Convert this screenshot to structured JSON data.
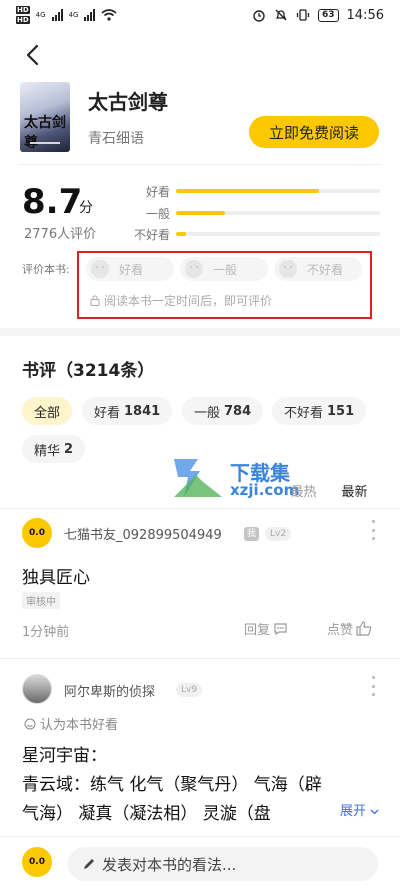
{
  "status_bar": {
    "left_tags": [
      "HD",
      "HD"
    ],
    "network": [
      "4G",
      "4G"
    ],
    "battery": "63",
    "time": "14:56"
  },
  "book": {
    "title": "太古剑尊",
    "author": "青石细语",
    "cover_text": "太古剑尊",
    "read_button": "立即免费阅读"
  },
  "rating": {
    "score": "8.7",
    "unit": "分",
    "count": "2776人评价",
    "bars": [
      {
        "label": "好看",
        "fraction": 0.7
      },
      {
        "label": "一般",
        "fraction": 0.24
      },
      {
        "label": "不好看",
        "fraction": 0.05
      }
    ],
    "my_rating_label": "评价本书:",
    "options": [
      "好看",
      "一般",
      "不好看"
    ],
    "locked_tip": "阅读本书一定时间后，即可评价"
  },
  "reviews": {
    "title": "书评（3214条）",
    "filters": [
      {
        "label": "全部",
        "count": ""
      },
      {
        "label": "好看",
        "count": "1841"
      },
      {
        "label": "一般",
        "count": "784"
      },
      {
        "label": "不好看",
        "count": "151"
      },
      {
        "label": "精华",
        "count": "2"
      }
    ],
    "sort": [
      "最热",
      "最新"
    ],
    "items": [
      {
        "username": "七猫书友_092899504949",
        "badge": "我",
        "level": "Lv2",
        "avatar_text": "0.0",
        "text": "独具匠心",
        "status": "审核中",
        "time": "1分钟前",
        "reply": "回复",
        "like": "点赞"
      },
      {
        "username": "阿尔卑斯的侦探",
        "level": "Lv9",
        "opinion": "认为本书好看",
        "line1": "星河宇宙：",
        "line2": "青云域：练气 化气（聚气丹） 气海（辟",
        "line3": "气海） 凝真（凝法相） 灵漩（盘",
        "expand": "展开"
      }
    ]
  },
  "watermark": {
    "text1": "下载集",
    "text2": "xzji.com"
  },
  "bottom": {
    "avatar_text": "0.0",
    "placeholder": "发表对本书的看法..."
  }
}
